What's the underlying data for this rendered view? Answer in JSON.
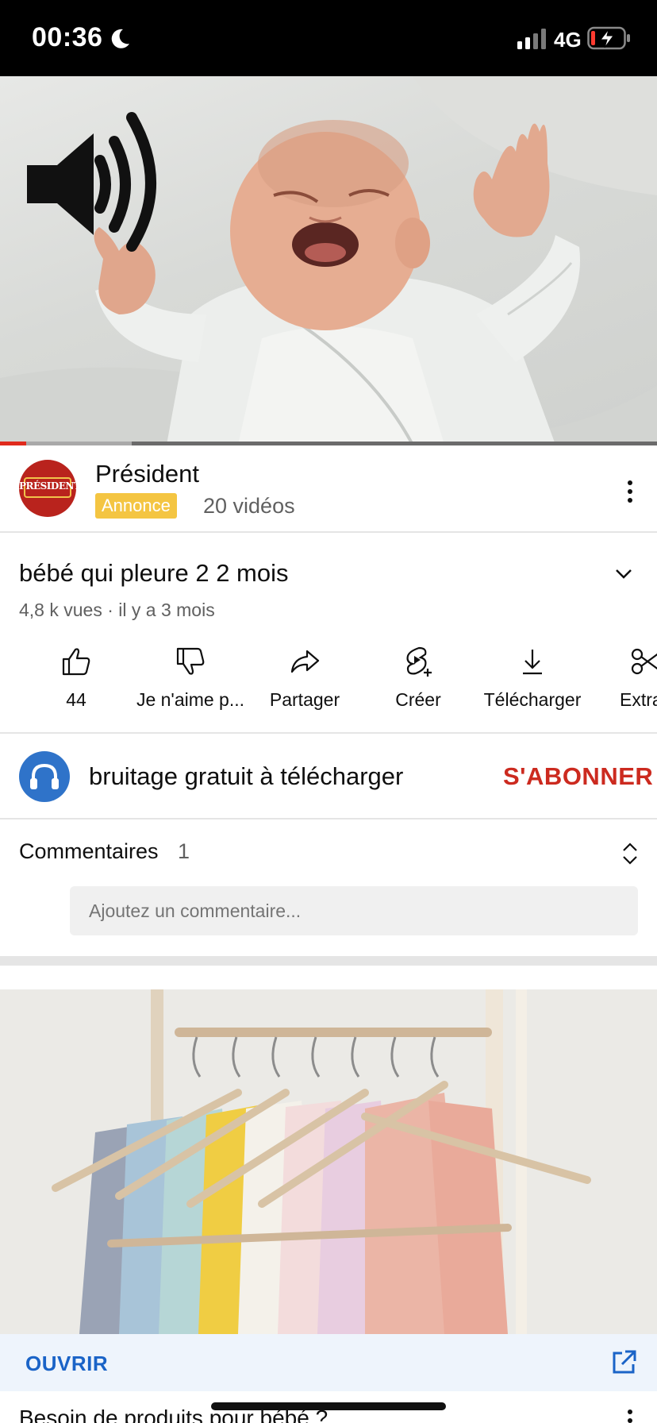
{
  "status_bar": {
    "time": "00:36",
    "network": "4G"
  },
  "video": {
    "progress_percent": 4,
    "buffered_percent": 20
  },
  "ad": {
    "logo_text": "PRÉSIDENT",
    "name": "Président",
    "badge": "Annonce",
    "videos": "20 vidéos"
  },
  "video_info": {
    "title": "bébé qui pleure 2  2 mois",
    "meta": "4,8 k vues · il y a 3 mois"
  },
  "actions": {
    "like": "44",
    "dislike": "Je n'aime p...",
    "share": "Partager",
    "create": "Créer",
    "download": "Télécharger",
    "extract": "Extra"
  },
  "channel": {
    "name": "bruitage gratuit à télécharger",
    "subscribe": "S'ABONNER"
  },
  "comments": {
    "label": "Commentaires",
    "count": "1",
    "placeholder": "Ajoutez un commentaire..."
  },
  "ad_card": {
    "open_label": "OUVRIR",
    "headline": "Besoin de produits pour bébé ?"
  },
  "colors": {
    "accent_red": "#cc2a1f",
    "link_blue": "#1a63c7",
    "badge_yellow": "#f4c542"
  }
}
